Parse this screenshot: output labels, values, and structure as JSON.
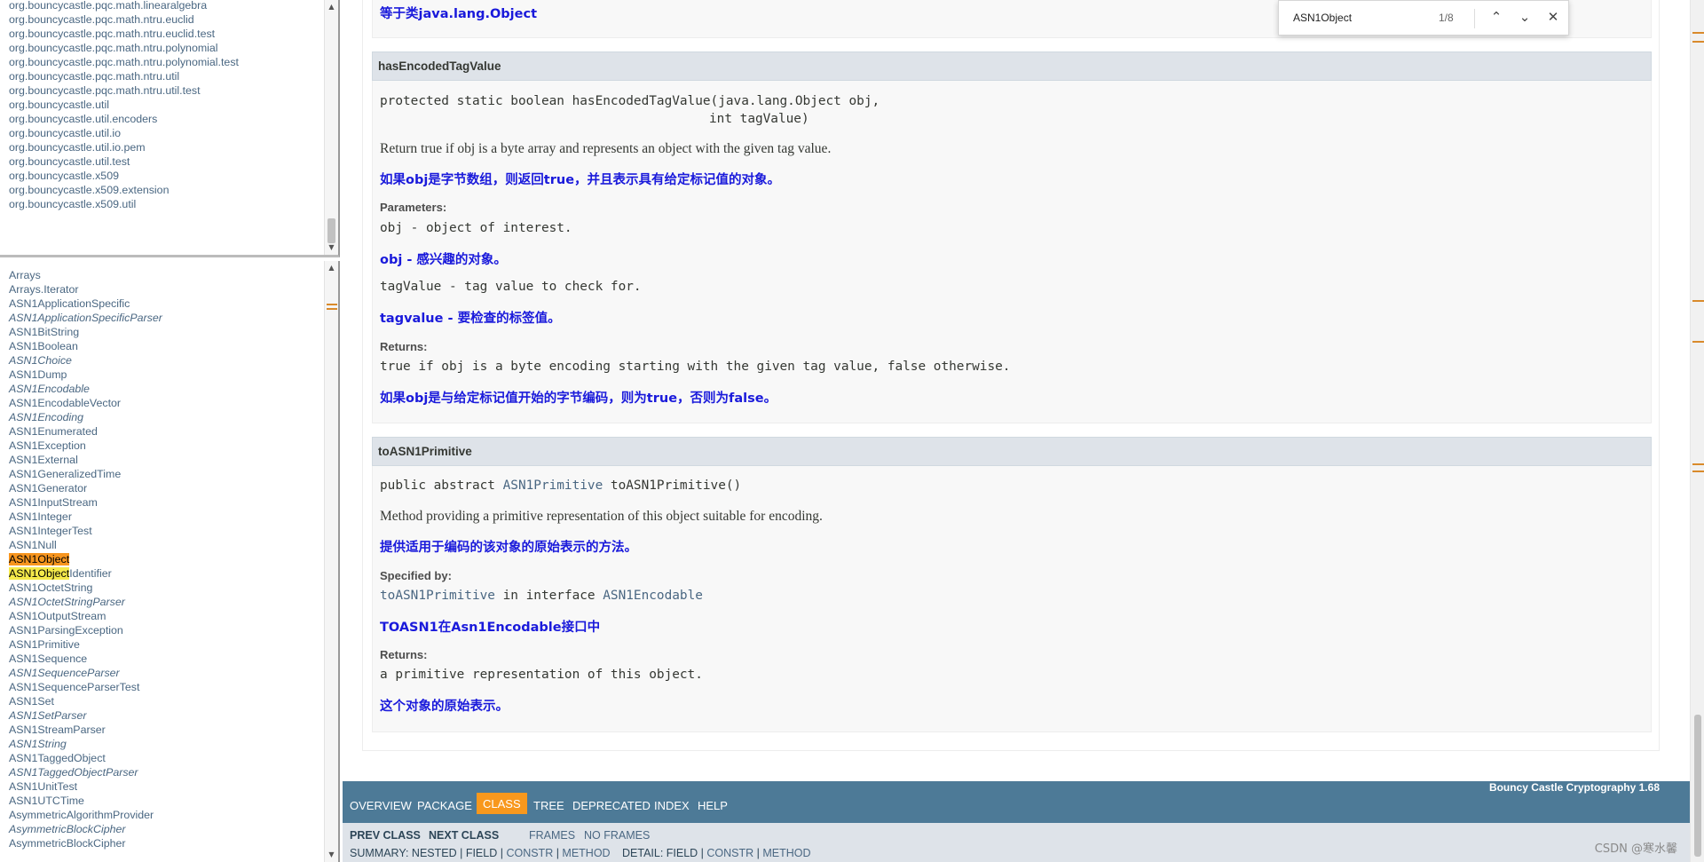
{
  "packages": [
    "org.bouncycastle.pqc.math.linearalgebra",
    "org.bouncycastle.pqc.math.ntru.euclid",
    "org.bouncycastle.pqc.math.ntru.euclid.test",
    "org.bouncycastle.pqc.math.ntru.polynomial",
    "org.bouncycastle.pqc.math.ntru.polynomial.test",
    "org.bouncycastle.pqc.math.ntru.util",
    "org.bouncycastle.pqc.math.ntru.util.test",
    "org.bouncycastle.util",
    "org.bouncycastle.util.encoders",
    "org.bouncycastle.util.io",
    "org.bouncycastle.util.io.pem",
    "org.bouncycastle.util.test",
    "org.bouncycastle.x509",
    "org.bouncycastle.x509.extension",
    "org.bouncycastle.x509.util"
  ],
  "classes": [
    {
      "name": "Arrays",
      "italic": false
    },
    {
      "name": "Arrays.Iterator",
      "italic": false
    },
    {
      "name": "ASN1ApplicationSpecific",
      "italic": false
    },
    {
      "name": "ASN1ApplicationSpecificParser",
      "italic": true
    },
    {
      "name": "ASN1BitString",
      "italic": false
    },
    {
      "name": "ASN1Boolean",
      "italic": false
    },
    {
      "name": "ASN1Choice",
      "italic": true
    },
    {
      "name": "ASN1Dump",
      "italic": false
    },
    {
      "name": "ASN1Encodable",
      "italic": true
    },
    {
      "name": "ASN1EncodableVector",
      "italic": false
    },
    {
      "name": "ASN1Encoding",
      "italic": true
    },
    {
      "name": "ASN1Enumerated",
      "italic": false
    },
    {
      "name": "ASN1Exception",
      "italic": false
    },
    {
      "name": "ASN1External",
      "italic": false
    },
    {
      "name": "ASN1GeneralizedTime",
      "italic": false
    },
    {
      "name": "ASN1Generator",
      "italic": false
    },
    {
      "name": "ASN1InputStream",
      "italic": false
    },
    {
      "name": "ASN1Integer",
      "italic": false
    },
    {
      "name": "ASN1IntegerTest",
      "italic": false
    },
    {
      "name": "ASN1Null",
      "italic": false
    },
    {
      "name": "ASN1Object",
      "italic": false,
      "hl": "ASN1Object",
      "cur": true
    },
    {
      "name": "ASN1ObjectIdentifier",
      "italic": false,
      "hl": "ASN1Object",
      "rest": "Identifier"
    },
    {
      "name": "ASN1OctetString",
      "italic": false
    },
    {
      "name": "ASN1OctetStringParser",
      "italic": true
    },
    {
      "name": "ASN1OutputStream",
      "italic": false
    },
    {
      "name": "ASN1ParsingException",
      "italic": false
    },
    {
      "name": "ASN1Primitive",
      "italic": false
    },
    {
      "name": "ASN1Sequence",
      "italic": false
    },
    {
      "name": "ASN1SequenceParser",
      "italic": true
    },
    {
      "name": "ASN1SequenceParserTest",
      "italic": false
    },
    {
      "name": "ASN1Set",
      "italic": false
    },
    {
      "name": "ASN1SetParser",
      "italic": true
    },
    {
      "name": "ASN1StreamParser",
      "italic": false
    },
    {
      "name": "ASN1String",
      "italic": true
    },
    {
      "name": "ASN1TaggedObject",
      "italic": false
    },
    {
      "name": "ASN1TaggedObjectParser",
      "italic": true
    },
    {
      "name": "ASN1UnitTest",
      "italic": false
    },
    {
      "name": "ASN1UTCTime",
      "italic": false
    },
    {
      "name": "AsymmetricAlgorithmProvider",
      "italic": false
    },
    {
      "name": "AsymmetricBlockCipher",
      "italic": true
    },
    {
      "name": "AsymmetricBlockCipher",
      "italic": false
    }
  ],
  "main": {
    "top_cn": "等于类java.lang.Object",
    "m1": {
      "name": "hasEncodedTagValue",
      "sig1": "protected static boolean hasEncodedTagValue(java.lang.Object obj,",
      "sig2": "int tagValue)",
      "desc": "Return true if obj is a byte array and represents an object with the given tag value.",
      "desc_cn": "如果obj是字节数组，则返回true，并且表示具有给定标记值的对象。",
      "params_label": "Parameters:",
      "p1": "obj - object of interest.",
      "p1_cn": "obj - 感兴趣的对象。",
      "p2": "tagValue - tag value to check for.",
      "p2_cn": "tagvalue - 要检查的标签值。",
      "returns_label": "Returns:",
      "ret": "true if obj is a byte encoding starting with the given tag value, false otherwise.",
      "ret_cn": "如果obj是与给定标记值开始的字节编码，则为true，否则为false。"
    },
    "m2": {
      "name": "toASN1Primitive",
      "sig_pre": "public abstract ",
      "sig_type": "ASN1Primitive",
      "sig_post": " toASN1Primitive()",
      "desc": "Method providing a primitive representation of this object suitable for encoding.",
      "desc_cn": "提供适用于编码的该对象的原始表示的方法。",
      "spec_label": "Specified by:",
      "spec_link": "toASN1Primitive",
      "spec_mid": " in interface ",
      "spec_iface": "ASN1Encodable",
      "spec_cn": "TOASN1在Asn1Encodable接口中",
      "returns_label": "Returns:",
      "ret": "a primitive representation of this object.",
      "ret_cn": "这个对象的原始表示。"
    }
  },
  "nav": {
    "overview": "OVERVIEW",
    "package": "PACKAGE",
    "class": "CLASS",
    "tree": "TREE",
    "deprecated": "DEPRECATED",
    "index": "INDEX",
    "help": "HELP",
    "brand": "Bouncy Castle Cryptography 1.68"
  },
  "subnav": {
    "prev": "PREV CLASS",
    "next": "NEXT CLASS",
    "frames": "FRAMES",
    "noframes": "NO FRAMES",
    "summary_pre": "SUMMARY: NESTED | FIELD | ",
    "constr": "CONSTR",
    "bar": " | ",
    "method": "METHOD",
    "detail_pre": "DETAIL: FIELD | ",
    "constr2": "CONSTR",
    "bar2": " | ",
    "method2": "METHOD"
  },
  "find": {
    "query": "ASN1Object",
    "count": "1/8"
  },
  "watermark": "CSDN @寒水馨",
  "colors": {
    "nav_bg": "#4d7a97",
    "class_tab": "#f8981d",
    "highlight": "#f5e94a",
    "current_match": "#f7951e",
    "cn_text": "#1a1adb"
  }
}
